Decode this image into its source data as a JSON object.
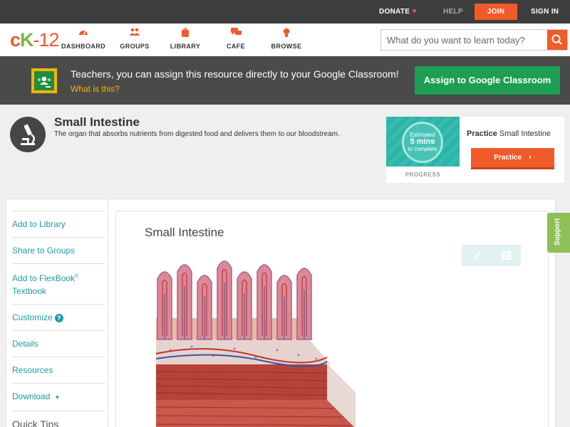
{
  "topbar": {
    "donate": "DONATE",
    "help": "HELP",
    "join": "JOIN",
    "signin": "SIGN IN"
  },
  "nav": {
    "logo_c": "c",
    "logo_k": "K",
    "logo_n": "-12",
    "items": [
      {
        "label": "DASHBOARD",
        "icon": "dashboard-gauge-icon"
      },
      {
        "label": "GROUPS",
        "icon": "groups-people-icon"
      },
      {
        "label": "LIBRARY",
        "icon": "library-bag-icon"
      },
      {
        "label": "CAFE",
        "icon": "cafe-chat-icon"
      },
      {
        "label": "BROWSE",
        "icon": "browse-bulb-icon"
      }
    ],
    "search_placeholder": "What do you want to learn today?"
  },
  "banner": {
    "text": "Teachers, you can assign this resource directly to your Google Classroom!",
    "link": "What is this?",
    "button": "Assign to Google Classroom"
  },
  "concept": {
    "title": "Small Intestine",
    "description": "The organ that absorbs nutrients from digested food and delivers them to our bloodstream."
  },
  "practice": {
    "estimated": "Estimated",
    "mins": "5 mins",
    "to_complete": "to complete",
    "progress_label": "PROGRESS",
    "heading_bold": "Practice",
    "heading_rest": "Small Intestine",
    "button": "Practice"
  },
  "sidebar": {
    "add_library": "Add to Library",
    "share_groups": "Share to Groups",
    "flexbook_line1": "Add to FlexBook",
    "flexbook_reg": "®",
    "flexbook_line2": "Textbook",
    "customize": "Customize",
    "details": "Details",
    "resources": "Resources",
    "download": "Download",
    "quick_tips": "Quick Tips"
  },
  "content": {
    "title": "Small Intestine"
  },
  "support": "Support",
  "colors": {
    "accent": "#f15a29",
    "teal": "#1f9aa8",
    "green": "#1e9e53",
    "support": "#8fc057"
  }
}
